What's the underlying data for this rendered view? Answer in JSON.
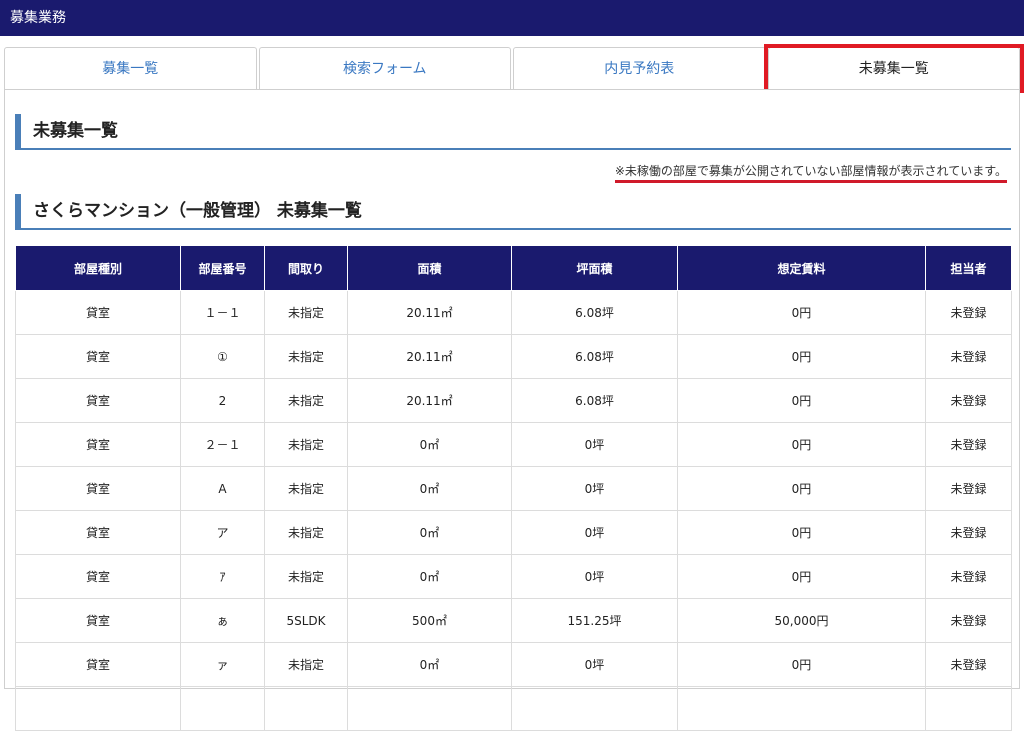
{
  "header": {
    "title": "募集業務"
  },
  "tabs": [
    {
      "label": "募集一覧"
    },
    {
      "label": "検索フォーム"
    },
    {
      "label": "内見予約表"
    },
    {
      "label": "未募集一覧"
    }
  ],
  "section1": {
    "title": "未募集一覧"
  },
  "note": "※未稼働の部屋で募集が公開されていない部屋情報が表示されています。",
  "section2": {
    "title": "さくらマンション（一般管理） 未募集一覧"
  },
  "table": {
    "headers": [
      "部屋種別",
      "部屋番号",
      "間取り",
      "面積",
      "坪面積",
      "想定賃料",
      "担当者"
    ],
    "rows": [
      [
        "貸室",
        "１－１",
        "未指定",
        "20.11㎡",
        "6.08坪",
        "0円",
        "未登録"
      ],
      [
        "貸室",
        "①",
        "未指定",
        "20.11㎡",
        "6.08坪",
        "0円",
        "未登録"
      ],
      [
        "貸室",
        "2",
        "未指定",
        "20.11㎡",
        "6.08坪",
        "0円",
        "未登録"
      ],
      [
        "貸室",
        "２－１",
        "未指定",
        "0㎡",
        "0坪",
        "0円",
        "未登録"
      ],
      [
        "貸室",
        "A",
        "未指定",
        "0㎡",
        "0坪",
        "0円",
        "未登録"
      ],
      [
        "貸室",
        "ア",
        "未指定",
        "0㎡",
        "0坪",
        "0円",
        "未登録"
      ],
      [
        "貸室",
        "ｱ",
        "未指定",
        "0㎡",
        "0坪",
        "0円",
        "未登録"
      ],
      [
        "貸室",
        "ぁ",
        "5SLDK",
        "500㎡",
        "151.25坪",
        "50,000円",
        "未登録"
      ],
      [
        "貸室",
        "ァ",
        "未指定",
        "0㎡",
        "0坪",
        "0円",
        "未登録"
      ],
      [
        "",
        "",
        "",
        "",
        "",
        "",
        ""
      ]
    ]
  }
}
